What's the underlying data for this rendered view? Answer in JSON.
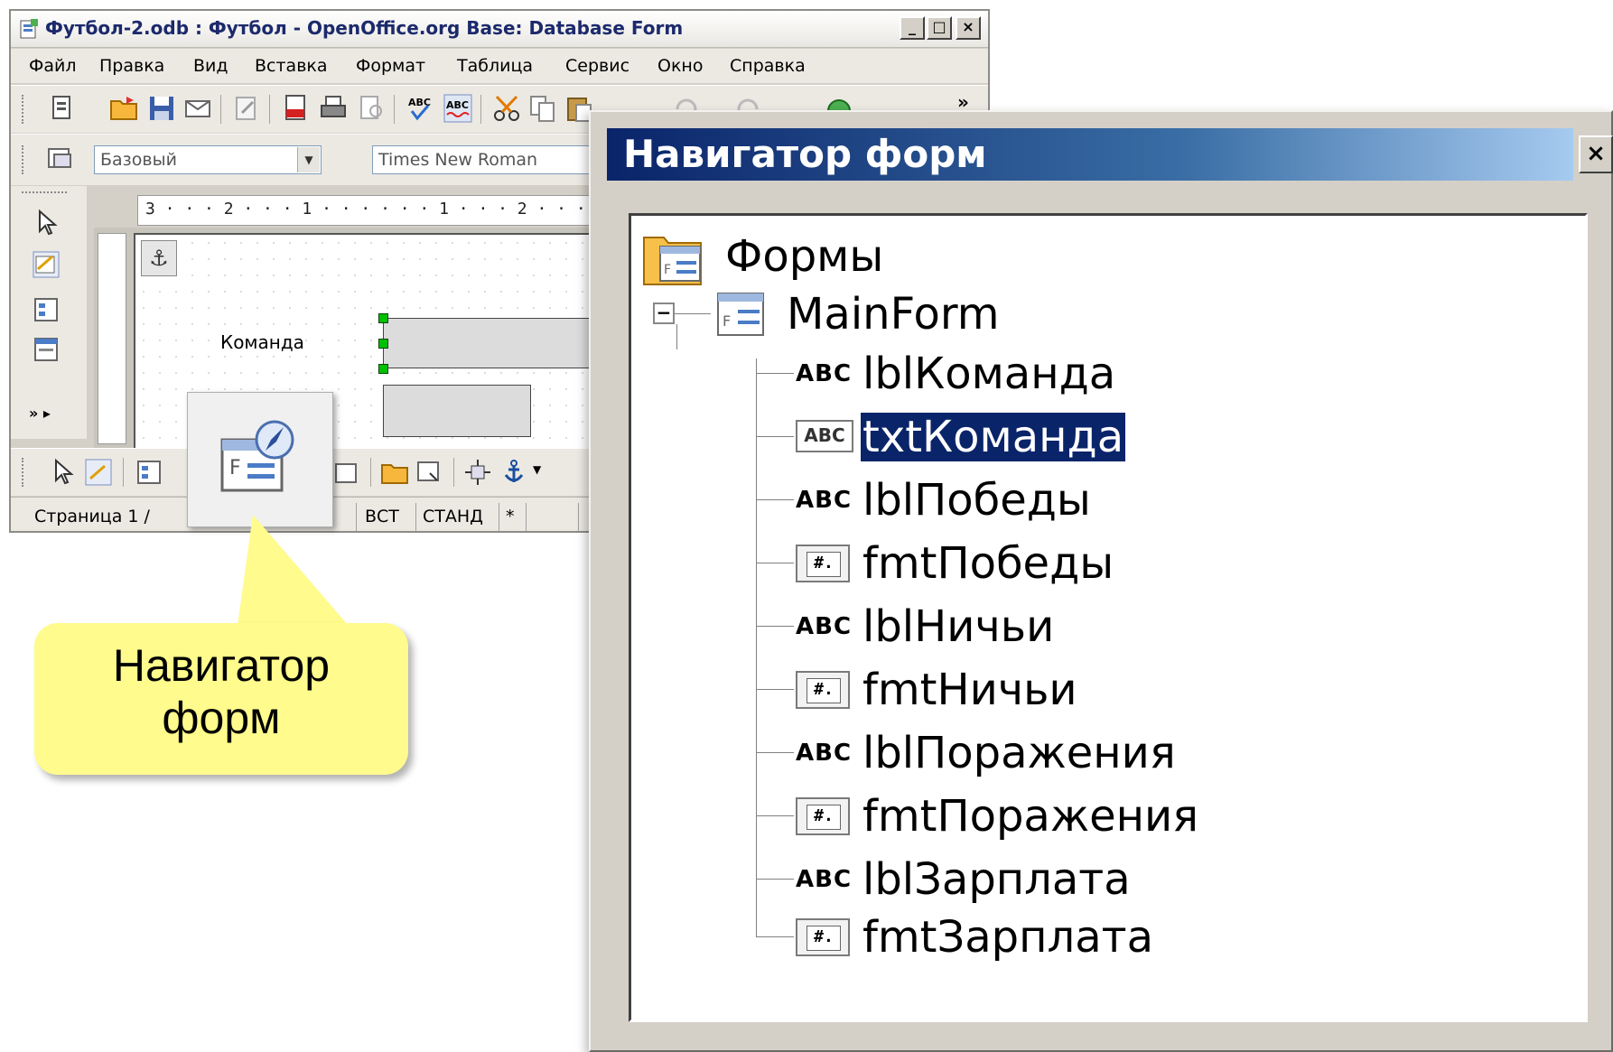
{
  "main_window": {
    "title": "Футбол-2.odb : Футбол - OpenOffice.org Base: Database Form",
    "controls": {
      "minimize": "_",
      "maximize": "□",
      "close": "×"
    },
    "menu": [
      "Файл",
      "Правка",
      "Вид",
      "Вставка",
      "Формат",
      "Таблица",
      "Сервис",
      "Окно",
      "Справка"
    ],
    "toolbar_overflow": "»",
    "style_combo": "Базовый",
    "font_combo": "Times New Roman",
    "ruler_text": "3 · · · 2 · · · 1 · · ·   · · · 1 · · · 2 · · ·",
    "form_label": "Команда",
    "status": {
      "page": "Страница  1 / ",
      "insert": "ВСТ",
      "mode": "СТАНД",
      "modified": "*"
    }
  },
  "callout": {
    "line1": "Навигатор",
    "line2": "форм"
  },
  "navigator": {
    "title": "Навигатор форм",
    "close": "×",
    "root_label": "Формы",
    "form_label": "MainForm",
    "collapse_symbol": "−",
    "items": [
      {
        "icon": "label-icon",
        "name": "lblКоманда"
      },
      {
        "icon": "textbox-icon",
        "name": "txtКоманда",
        "selected": true
      },
      {
        "icon": "label-icon",
        "name": "lblПобеды"
      },
      {
        "icon": "formatted-field-icon",
        "name": "fmtПобеды"
      },
      {
        "icon": "label-icon",
        "name": "lblНичьи"
      },
      {
        "icon": "formatted-field-icon",
        "name": "fmtНичьи"
      },
      {
        "icon": "label-icon",
        "name": "lblПоражения"
      },
      {
        "icon": "formatted-field-icon",
        "name": "fmtПоражения"
      },
      {
        "icon": "label-icon",
        "name": "lblЗарплата"
      },
      {
        "icon": "formatted-field-icon",
        "name": "fmtЗарплата"
      }
    ],
    "icon_texts": {
      "label": "ABC",
      "textbox": "ABC",
      "formatted": "#."
    }
  }
}
